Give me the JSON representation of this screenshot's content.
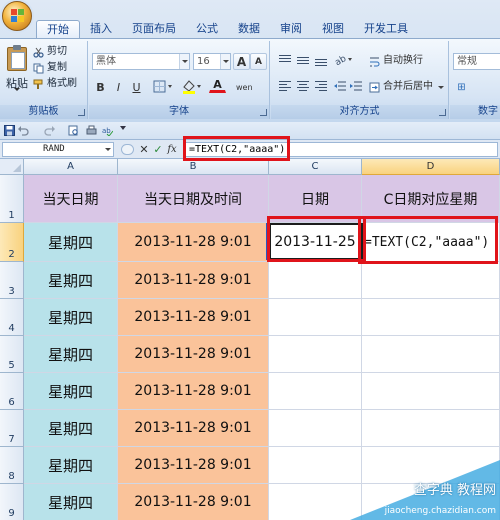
{
  "ribbon": {
    "tabs": [
      "开始",
      "插入",
      "页面布局",
      "公式",
      "数据",
      "审阅",
      "视图",
      "开发工具"
    ],
    "active_tab": "开始",
    "clipboard": {
      "paste_label": "粘贴",
      "cut_label": "剪切",
      "copy_label": "复制",
      "format_painter_label": "格式刷",
      "group_label": "剪贴板"
    },
    "font": {
      "font_name": "黑体",
      "font_size": "16",
      "grow_label": "A",
      "shrink_label": "A",
      "bold": "B",
      "italic": "I",
      "underline": "U",
      "font_color_label": "A",
      "phonetic_label": "wen",
      "group_label": "字体"
    },
    "alignment": {
      "wrap_text_label": "自动换行",
      "merge_center_label": "合并后居中",
      "group_label": "对齐方式"
    },
    "number": {
      "format_value": "常规",
      "group_label": "数字"
    }
  },
  "formula_bar": {
    "name_box": "RAND",
    "cancel_symbol": "✕",
    "enter_symbol": "✓",
    "fx_label": "fx",
    "formula": "=TEXT(C2,\"aaaa\")"
  },
  "grid": {
    "columns": [
      "A",
      "B",
      "C",
      "D"
    ],
    "rows": [
      "1",
      "2",
      "3",
      "4",
      "5",
      "6",
      "7",
      "8",
      "9"
    ],
    "header_row": {
      "a": "当天日期",
      "b": "当天日期及时间",
      "c": "日期",
      "d": "C日期对应星期"
    },
    "data_rows": [
      {
        "a": "星期四",
        "b": "2013-11-28  9:01",
        "c": "2013-11-25",
        "d": "=TEXT(C2,\"aaaa\")"
      },
      {
        "a": "星期四",
        "b": "2013-11-28  9:01",
        "c": "",
        "d": ""
      },
      {
        "a": "星期四",
        "b": "2013-11-28  9:01",
        "c": "",
        "d": ""
      },
      {
        "a": "星期四",
        "b": "2013-11-28  9:01",
        "c": "",
        "d": ""
      },
      {
        "a": "星期四",
        "b": "2013-11-28  9:01",
        "c": "",
        "d": ""
      },
      {
        "a": "星期四",
        "b": "2013-11-28  9:01",
        "c": "",
        "d": ""
      },
      {
        "a": "星期四",
        "b": "2013-11-28  9:01",
        "c": "",
        "d": ""
      },
      {
        "a": "星期四",
        "b": "2013-11-28  9:01",
        "c": "",
        "d": ""
      }
    ]
  },
  "watermark": {
    "line1": "查字典 教程网",
    "line2": "jiaocheng.chazidian.com"
  },
  "colors": {
    "col_a_fill": "#b8e2ea",
    "col_b_fill": "#fac39a",
    "header_fill": "#d9c6e6",
    "highlight_red": "#e0141b"
  }
}
